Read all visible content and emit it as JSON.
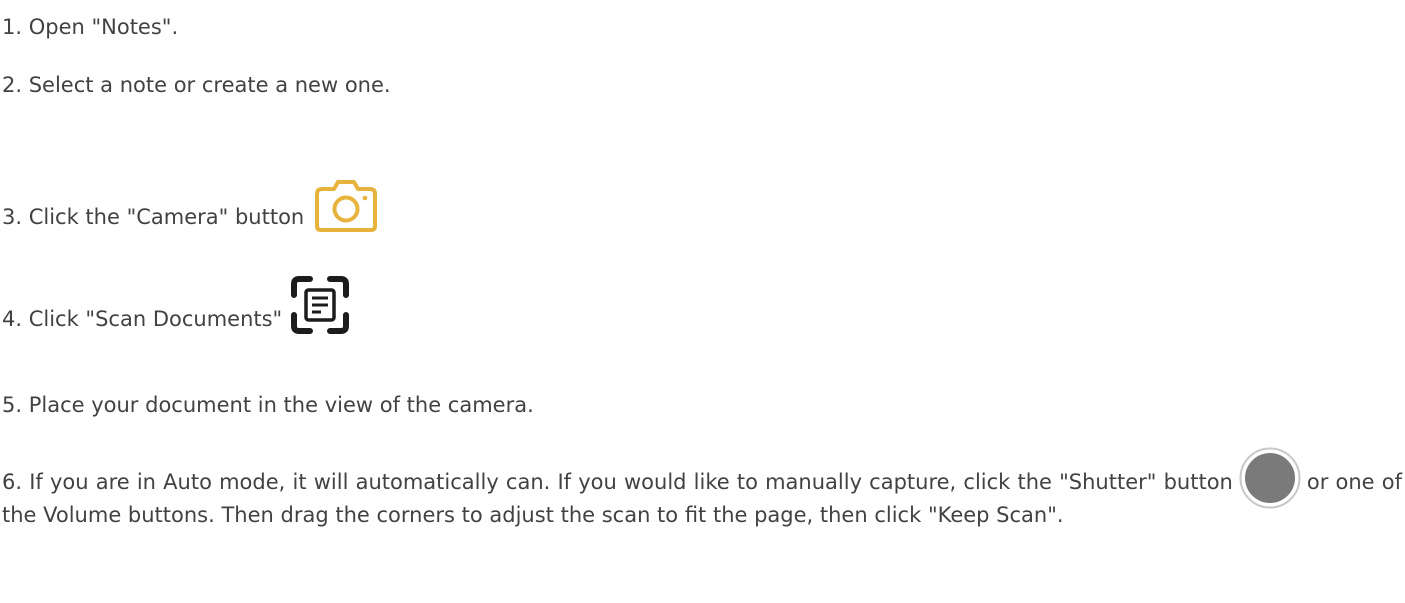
{
  "steps": [
    {
      "text": "1. Open \"Notes\"."
    },
    {
      "text": "2. Select a note or create a new one."
    },
    {
      "text": "3. Click the \"Camera\" button",
      "icon": "camera-icon"
    },
    {
      "text": "4. Click \"Scan Documents\"",
      "icon": "scan-document-icon"
    },
    {
      "text": "5. Place your document in the view of the camera."
    },
    {
      "text_before": "6. If you are in Auto mode, it will automatically can. If you would like to manually capture, click the \"Shutter\" button",
      "icon": "shutter-icon",
      "text_after": "or one of the Volume buttons. Then drag the corners to adjust the scan to fit the page, then click \"Keep Scan\"."
    }
  ],
  "colors": {
    "text": "#424242",
    "camera_icon": "#E8B33C",
    "scan_icon": "#1C1C1C",
    "shutter_fill": "#7A7A7A",
    "shutter_ring": "#C8C8C8"
  }
}
